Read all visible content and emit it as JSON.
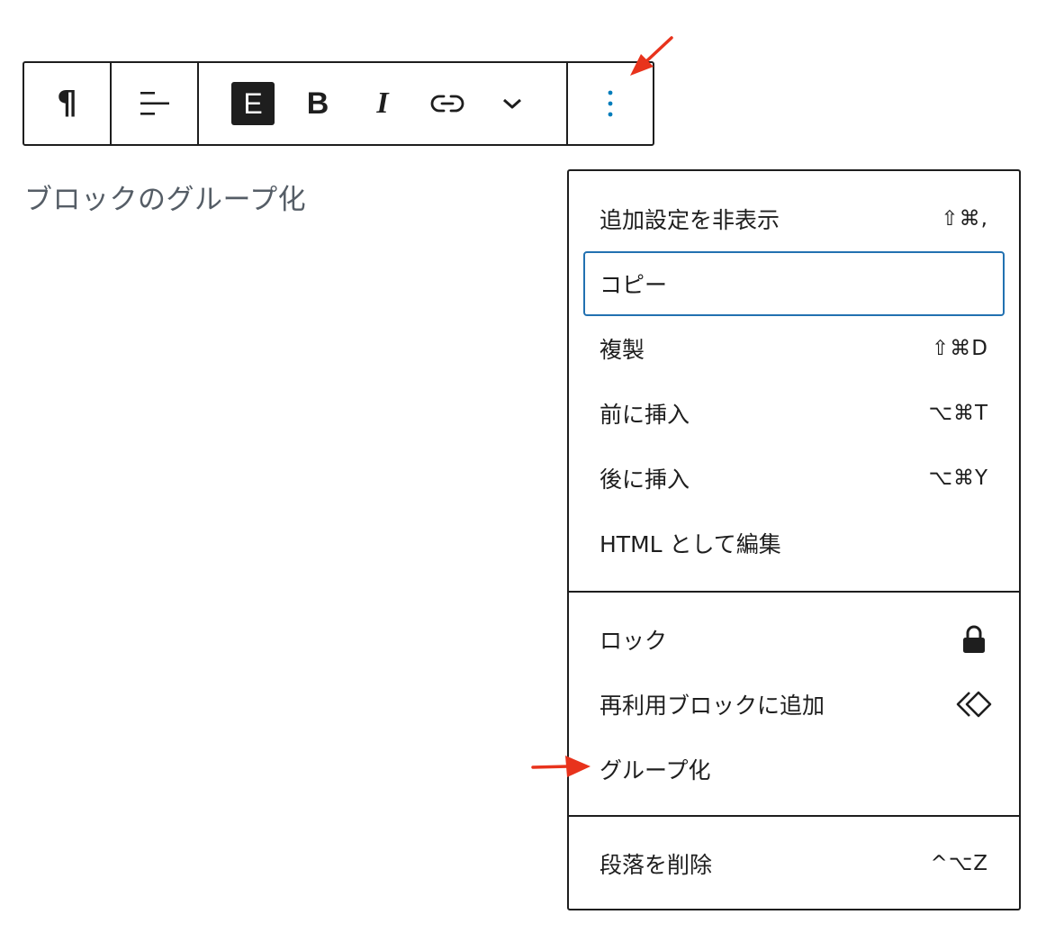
{
  "toolbar": {
    "paragraph_icon": "¶",
    "align_icon": "align-left-icon",
    "e_label": "E",
    "bold_label": "B",
    "italic_label": "I",
    "link_icon": "link-icon",
    "more_icon": "chevron-down-icon",
    "options_icon": "more-vertical-icon",
    "accent_color": "#007cba"
  },
  "content": {
    "paragraph_text": "ブロックのグループ化"
  },
  "menu": {
    "section1": [
      {
        "label": "追加設定を非表示",
        "shortcut": "⇧⌘,"
      },
      {
        "label": "コピー",
        "shortcut": ""
      },
      {
        "label": "複製",
        "shortcut": "⇧⌘D"
      },
      {
        "label": "前に挿入",
        "shortcut": "⌥⌘T"
      },
      {
        "label": "後に挿入",
        "shortcut": "⌥⌘Y"
      },
      {
        "label": "HTML として編集",
        "shortcut": ""
      }
    ],
    "section2": [
      {
        "label": "ロック",
        "icon": "lock-icon"
      },
      {
        "label": "再利用ブロックに追加",
        "icon": "reusable-block-icon"
      },
      {
        "label": "グループ化",
        "icon": ""
      }
    ],
    "section3": [
      {
        "label": "段落を削除",
        "shortcut": "^⌥Z"
      }
    ],
    "focus_color": "#2271b1"
  },
  "annotations": {
    "arrow_color": "#e8331c"
  }
}
